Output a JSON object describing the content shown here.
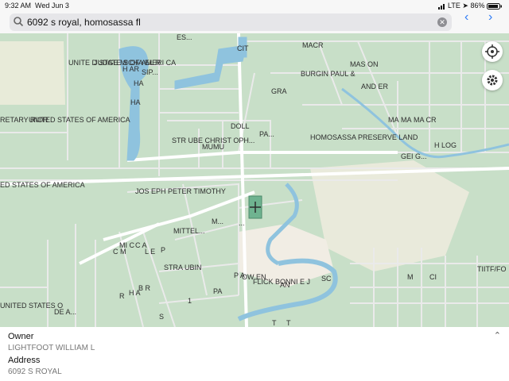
{
  "status_bar": {
    "time": "9:32 AM",
    "date": "Wed Jun 3",
    "network": "LTE",
    "battery": "86%"
  },
  "search": {
    "value": "6092 s royal, homosassa fl"
  },
  "map": {
    "labels": [
      "ES...",
      "UNITE D STATE S OF AMERI CA",
      "JUDGE MICHA EL R",
      "H AR",
      "SIP...",
      "HA",
      "HA",
      "CIT",
      "MACR",
      "BURGIN PAUL &",
      "MAS ON",
      "AND ER",
      "GRA",
      "RETARY RIOR",
      "UNITED STATES OF AMERICA",
      "STR UBE CHRIST OPH...",
      "MUMU",
      "DOLL",
      "PA...",
      "HOMOSASSA PRESERVE LAND",
      "MA",
      "MA",
      "MA CR",
      "H LOG",
      "GEI G...",
      "ED STATES OF AMERICA",
      "JOS EPH PETER TIMOTHY",
      "M...",
      "MITTEL...",
      "C M",
      "MI C",
      "C A",
      "L E",
      "P",
      "STRA UBIN",
      "R",
      "H A",
      "B R",
      "PA",
      "P A",
      "OW EN",
      "FLICK BONNI E J",
      "AN",
      "SC",
      "M",
      "CI",
      "TIITF/FO",
      "UNITED STATES O",
      "DE A...",
      "S",
      "1",
      "T",
      "T",
      "..."
    ]
  },
  "panel": {
    "owner_label": "Owner",
    "owner_value": "LIGHTFOOT WILLIAM L",
    "address_label": "Address",
    "address_value": "6092 S ROYAL"
  }
}
